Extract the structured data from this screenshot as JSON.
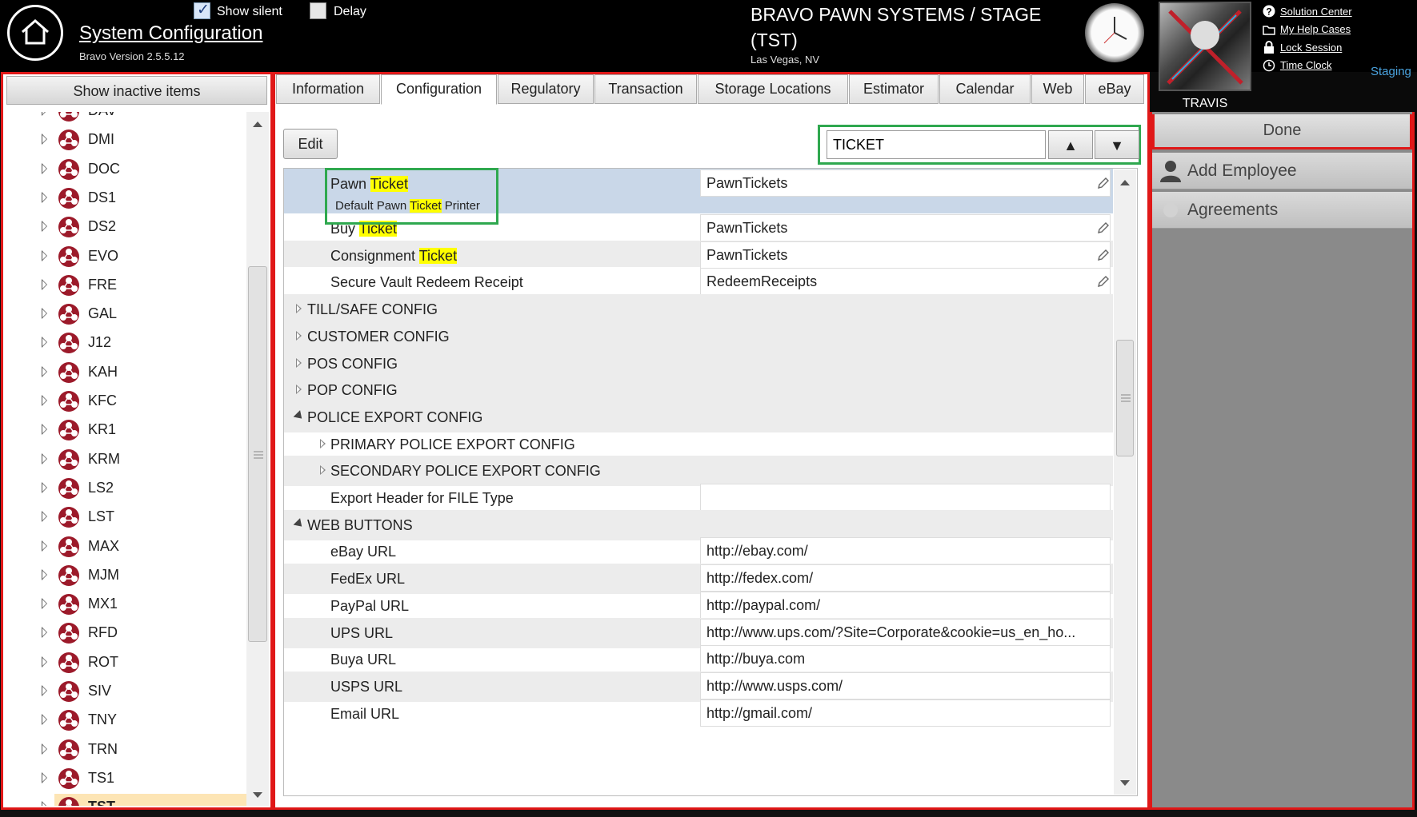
{
  "header": {
    "title": "System Configuration",
    "version": "Bravo Version 2.5.5.12",
    "show_silent_label": "Show silent",
    "show_silent_checked": true,
    "delay_label": "Delay",
    "delay_checked": false,
    "company": "BRAVO PAWN SYSTEMS / STAGE (TST)",
    "location": "Las Vegas, NV",
    "user": "TRAVIS",
    "environment": "Staging",
    "links": [
      {
        "label": "Solution Center",
        "icon": "help-circle-icon"
      },
      {
        "label": "My Help Cases",
        "icon": "folder-icon"
      },
      {
        "label": "Lock Session",
        "icon": "lock-icon"
      },
      {
        "label": "Time Clock",
        "icon": "clock-icon"
      }
    ]
  },
  "left_panel": {
    "show_inactive_label": "Show inactive items",
    "stores": [
      "DAV",
      "DMI",
      "DOC",
      "DS1",
      "DS2",
      "EVO",
      "FRE",
      "GAL",
      "J12",
      "KAH",
      "KFC",
      "KR1",
      "KRM",
      "LS2",
      "LST",
      "MAX",
      "MJM",
      "MX1",
      "RFD",
      "ROT",
      "SIV",
      "TNY",
      "TRN",
      "TS1",
      "TST"
    ],
    "selected": "TST"
  },
  "tabs": [
    "Information",
    "Configuration",
    "Regulatory",
    "Transaction",
    "Storage Locations",
    "Estimator",
    "Calendar",
    "Web",
    "eBay"
  ],
  "active_tab": "Configuration",
  "toolbar": {
    "edit_label": "Edit",
    "search_value": "TICKET",
    "up_label": "▲",
    "down_label": "▼"
  },
  "grid": {
    "printer_rows": [
      {
        "name_pre": "Pawn ",
        "name_hl": "Ticket",
        "value": "PawnTickets",
        "desc_pre": "Default Pawn ",
        "desc_hl": "Ticket",
        "desc_post": " Printer"
      },
      {
        "name_pre": "Buy ",
        "name_hl": "Ticket",
        "value": "PawnTickets"
      },
      {
        "name_pre": "Consignment ",
        "name_hl": "Ticket",
        "value": "PawnTickets"
      },
      {
        "name_pre": "Secure Vault Redeem Receipt",
        "name_hl": "",
        "value": "RedeemReceipts"
      }
    ],
    "groups": [
      "TILL/SAFE CONFIG",
      "CUSTOMER CONFIG",
      "POS CONFIG",
      "POP CONFIG",
      "POLICE EXPORT CONFIG"
    ],
    "police_subgroups": [
      "PRIMARY POLICE EXPORT CONFIG",
      "SECONDARY POLICE EXPORT CONFIG"
    ],
    "export_header": {
      "name": "Export Header for FILE Type",
      "value": ""
    },
    "web_group": "WEB BUTTONS",
    "web_rows": [
      {
        "name": "eBay URL",
        "value": "http://ebay.com/"
      },
      {
        "name": "FedEx URL",
        "value": "http://fedex.com/"
      },
      {
        "name": "PayPal URL",
        "value": "http://paypal.com/"
      },
      {
        "name": "UPS URL",
        "value": "http://www.ups.com/?Site=Corporate&cookie=us_en_ho..."
      },
      {
        "name": "Buya URL",
        "value": "http://buya.com"
      },
      {
        "name": "USPS URL",
        "value": "http://www.usps.com/"
      },
      {
        "name": "Email URL",
        "value": "http://gmail.com/"
      }
    ]
  },
  "right_panel": {
    "done_label": "Done",
    "items": [
      {
        "label": "Add Employee",
        "icon": "person-icon"
      },
      {
        "label": "Agreements",
        "icon": "circle-icon"
      }
    ]
  },
  "colors": {
    "highlight": "#ffff00",
    "red_frame": "#e01818",
    "green_frame": "#2fa84f",
    "staging": "#4aa3df"
  }
}
